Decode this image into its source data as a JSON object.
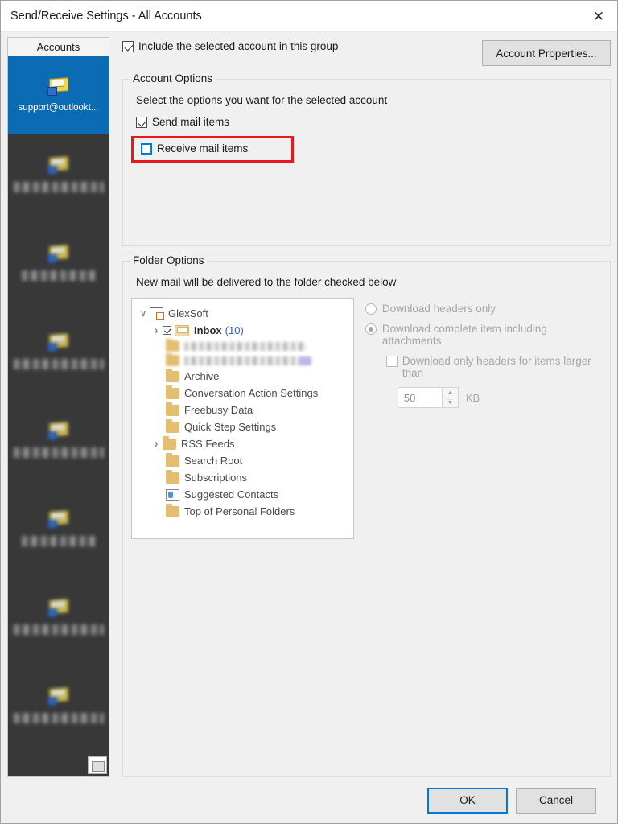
{
  "window": {
    "title": "Send/Receive Settings - All Accounts",
    "close_icon": "close-icon"
  },
  "sidebar": {
    "header": "Accounts",
    "selected_account": "support@outlookt...",
    "redacted_accounts": [
      "",
      "",
      "",
      "",
      "",
      "",
      ""
    ]
  },
  "toolbar": {
    "include_account_label": "Include the selected account in this group",
    "include_account_checked": true,
    "account_properties_label": "Account Properties..."
  },
  "account_options": {
    "legend": "Account Options",
    "hint": "Select the options you want for the selected account",
    "send_mail_label": "Send mail items",
    "send_mail_checked": true,
    "receive_mail_label": "Receive mail items",
    "receive_mail_checked": false,
    "highlight_color": "#e8191b"
  },
  "folder_options": {
    "legend": "Folder Options",
    "hint": "New mail will be delivered to the folder checked below",
    "tree": {
      "root_label": "GlexSoft",
      "inbox_label": "Inbox",
      "inbox_count": "(10)",
      "folders": [
        "Archive",
        "Conversation Action Settings",
        "Freebusy Data",
        "Quick Step Settings",
        "RSS Feeds",
        "Search Root",
        "Subscriptions",
        "Suggested Contacts",
        "Top of Personal Folders"
      ]
    },
    "download": {
      "headers_only_label": "Download headers only",
      "headers_only_selected": false,
      "complete_item_label": "Download complete item including attachments",
      "complete_item_selected": true,
      "large_items_label": "Download only headers for items larger than",
      "large_items_checked": false,
      "size_value": "50",
      "size_unit": "KB"
    }
  },
  "footer": {
    "ok_label": "OK",
    "cancel_label": "Cancel"
  }
}
